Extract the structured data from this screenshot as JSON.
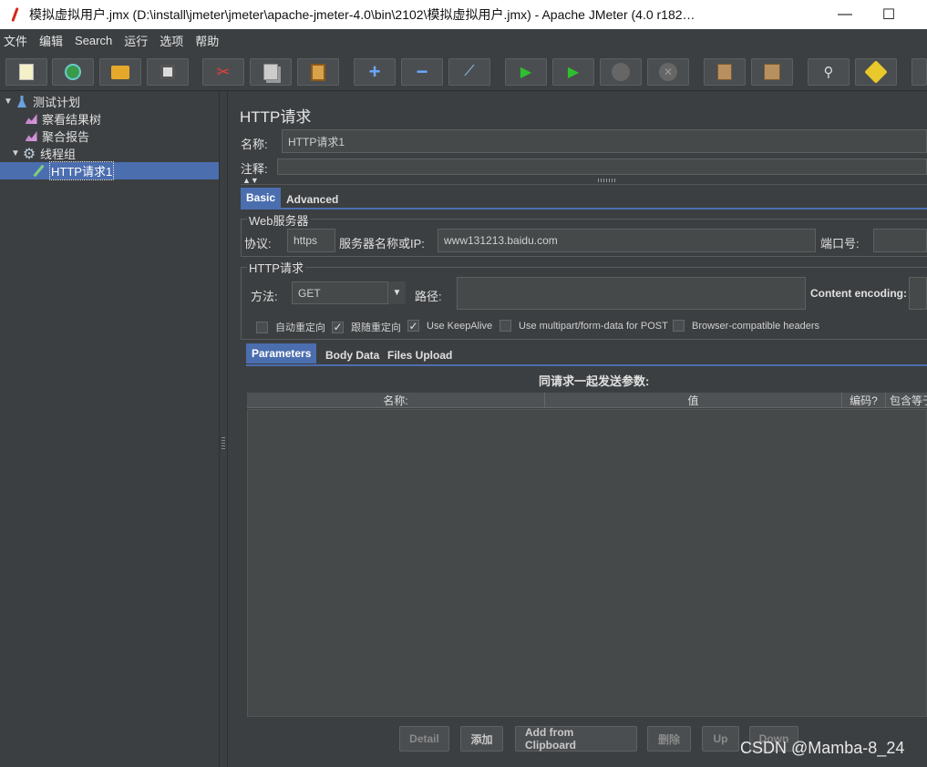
{
  "window": {
    "title": "模拟虚拟用户.jmx (D:\\install\\jmeter\\jmeter\\apache-jmeter-4.0\\bin\\2102\\模拟虚拟用户.jmx) - Apache JMeter (4.0 r182…",
    "minimize": "—",
    "maximize": "☐"
  },
  "menu": [
    "文件",
    "编辑",
    "Search",
    "运行",
    "选项",
    "帮助"
  ],
  "toolbar_icons": [
    "new-icon",
    "templates-icon",
    "open-icon",
    "save-icon",
    "cut-icon",
    "copy-icon",
    "paste-icon",
    "expand-icon",
    "collapse-icon",
    "toggle-icon",
    "start-icon",
    "start-no-pause-icon",
    "stop-icon",
    "shutdown-icon",
    "clear-icon",
    "clear-all-icon",
    "search-icon",
    "reset-search-icon",
    "more-icon"
  ],
  "tree": {
    "items": [
      {
        "label": "测试计划",
        "icon": "test-plan-icon",
        "toggle": "▼"
      },
      {
        "label": "察看结果树",
        "icon": "listener-icon",
        "toggle": ""
      },
      {
        "label": "聚合报告",
        "icon": "listener-icon",
        "toggle": ""
      },
      {
        "label": "线程组",
        "icon": "thread-group-icon",
        "toggle": "▼"
      },
      {
        "label": "HTTP请求1",
        "icon": "sampler-icon",
        "toggle": ""
      }
    ]
  },
  "panel": {
    "title": "HTTP请求",
    "name_label": "名称:",
    "name_value": "HTTP请求1",
    "comment_label": "注释:",
    "comment_value": "",
    "tabs": [
      "Basic",
      "Advanced"
    ],
    "web_server": {
      "group_title": "Web服务器",
      "protocol_label": "协议:",
      "protocol_value": "https",
      "server_label": "服务器名称或IP:",
      "server_value": "www131213.baidu.com",
      "port_label": "端口号:",
      "port_value": ""
    },
    "http_request": {
      "group_title": "HTTP请求",
      "method_label": "方法:",
      "method_value": "GET",
      "path_label": "路径:",
      "path_value": "",
      "encoding_label": "Content encoding:",
      "encoding_value": ""
    },
    "options": [
      {
        "label": "自动重定向",
        "checked": false
      },
      {
        "label": "跟随重定向",
        "checked": true
      },
      {
        "label": "Use KeepAlive",
        "checked": true
      },
      {
        "label": "Use multipart/form-data for POST",
        "checked": false
      },
      {
        "label": "Browser-compatible headers",
        "checked": false
      }
    ],
    "param_tabs": [
      "Parameters",
      "Body Data",
      "Files Upload"
    ],
    "table": {
      "caption": "同请求一起发送参数:",
      "columns": [
        "名称:",
        "值",
        "编码?",
        "包含等于"
      ]
    },
    "buttons": [
      {
        "label": "Detail",
        "enabled": false
      },
      {
        "label": "添加",
        "enabled": true
      },
      {
        "label": "Add from Clipboard",
        "enabled": true
      },
      {
        "label": "删除",
        "enabled": false
      },
      {
        "label": "Up",
        "enabled": false
      },
      {
        "label": "Down",
        "enabled": false
      }
    ]
  },
  "watermark": "CSDN @Mamba-8_24"
}
